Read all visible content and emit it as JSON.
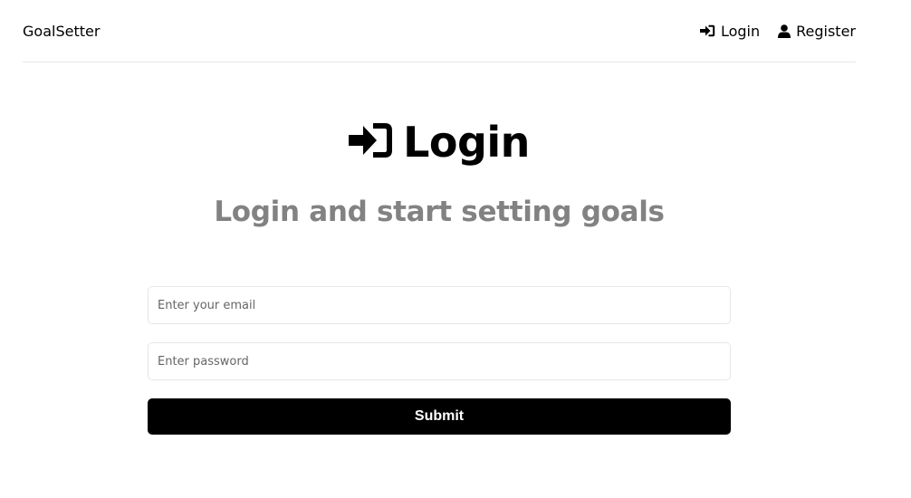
{
  "header": {
    "logo": "GoalSetter",
    "nav": [
      {
        "label": "Login",
        "icon": "sign-in-icon"
      },
      {
        "label": "Register",
        "icon": "user-icon"
      }
    ]
  },
  "main": {
    "heading": "Login",
    "heading_icon": "sign-in-icon",
    "subheading": "Login and start setting goals"
  },
  "form": {
    "email_placeholder": "Enter your email",
    "email_value": "",
    "password_placeholder": "Enter password",
    "password_value": "",
    "submit_label": "Submit"
  },
  "colors": {
    "primary": "#000000",
    "subheading": "#828282",
    "border": "#e6e6e6",
    "background": "#ffffff"
  }
}
